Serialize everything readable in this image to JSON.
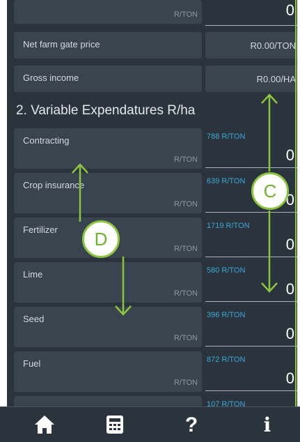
{
  "rows_top": {
    "partial_unit": "R/TON",
    "partial_value": "0",
    "net_farm_gate_price": {
      "label": "Net farm gate price",
      "value": "R0.00/TON"
    },
    "gross_income": {
      "label": "Gross income",
      "value": "R0.00/HA"
    }
  },
  "section_title": "2. Variable Expendatures R/ha",
  "items": [
    {
      "label": "Contracting",
      "unit": "R/TON",
      "hint": "788 R/TON",
      "value": "0"
    },
    {
      "label": "Crop insurance",
      "unit": "R/TON",
      "hint": "639 R/TON",
      "value": "0"
    },
    {
      "label": "Fertilizer",
      "unit": "R/TON",
      "hint": "1719 R/TON",
      "value": "0"
    },
    {
      "label": "Lime",
      "unit": "R/TON",
      "hint": "580 R/TON",
      "value": "0"
    },
    {
      "label": "Seed",
      "unit": "R/TON",
      "hint": "396 R/TON",
      "value": "0"
    },
    {
      "label": "Fuel",
      "unit": "R/TON",
      "hint": "872 R/TON",
      "value": "0"
    }
  ],
  "cut_hint": "107 R/TON",
  "callouts": {
    "c": "C",
    "d": "D"
  },
  "nav": {
    "icons": [
      "home-icon",
      "calculator-icon",
      "help-icon",
      "info-icon"
    ],
    "help_glyph": "?",
    "info_glyph": "i"
  },
  "colors": {
    "accent": "#8cc63f",
    "hint": "#3aa9d8",
    "background": "#2b343d"
  }
}
